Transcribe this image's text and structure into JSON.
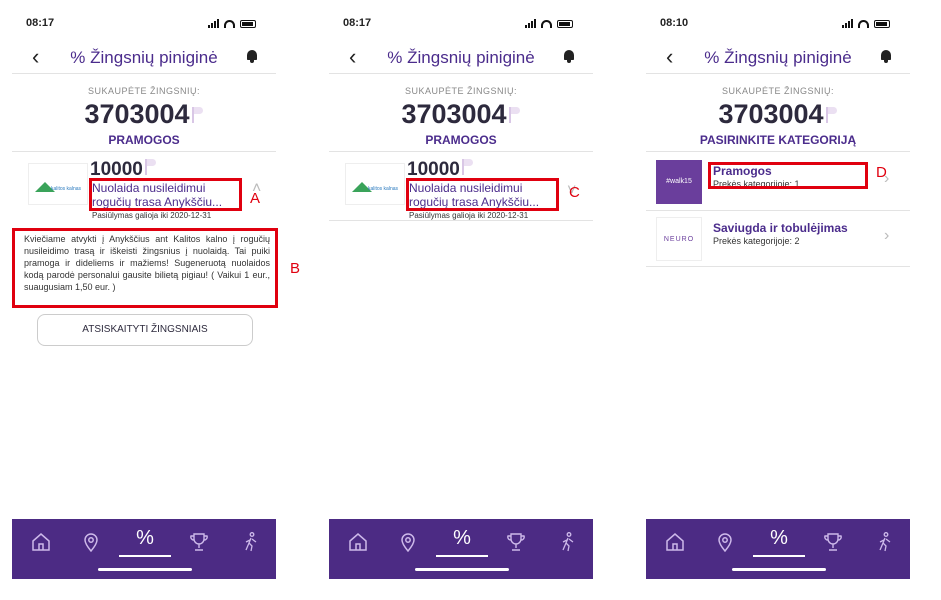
{
  "screens": [
    {
      "time": "08:17",
      "nav_title": "% Žingsnių piniginė",
      "earned_label": "SUKAUPĖTE ŽINGSNIŲ:",
      "steps": "3703004",
      "category": "PRAMOGOS",
      "offer": {
        "points": "10000",
        "name": "Nuolaida nusileidimui rogučių trasa Anykščiu...",
        "valid": "Pasiūlymas galioja iki 2020-12-31",
        "logo_text": "kalitos kalnas"
      },
      "description": "Kviečiame atvykti į Anykščius ant Kalitos kalno į rogučių nusileidimo trasą ir iškeisti žingsnius į nuolaidą. Tai puiki pramoga ir dideliems ir mažiems! Sugeneruotą nuolaidos kodą parodė personalui gausite bilietą pigiau! ( Vaikui 1 eur., suaugusiam 1,50 eur. )",
      "button": "ATSISKAITYTI ŽINGSNIAIS",
      "marks": [
        "A",
        "B"
      ]
    },
    {
      "time": "08:17",
      "nav_title": "% Žingsnių piniginė",
      "earned_label": "SUKAUPĖTE ŽINGSNIŲ:",
      "steps": "3703004",
      "category": "PRAMOGOS",
      "offer": {
        "points": "10000",
        "name": "Nuolaida nusileidimui rogučių trasa Anykščiu...",
        "valid": "Pasiūlymas galioja iki 2020-12-31",
        "logo_text": "kalitos kalnas"
      },
      "marks": [
        "C"
      ]
    },
    {
      "time": "08:10",
      "nav_title": "% Žingsnių piniginė",
      "earned_label": "SUKAUPĖTE ŽINGSNIŲ:",
      "steps": "3703004",
      "category": "PASIRINKITE KATEGORIJĄ",
      "categories": [
        {
          "title": "Pramogos",
          "sub": "Prekės kategorijoje: 1",
          "thumb": "#walk15"
        },
        {
          "title": "Saviugda ir tobulėjimas",
          "sub": "Prekės kategorijoje: 2",
          "thumb": "NEURO"
        }
      ],
      "marks": [
        "D"
      ]
    }
  ],
  "tabs": [
    "home-icon",
    "location-pin-icon",
    "percent-icon",
    "trophy-icon",
    "walking-icon"
  ],
  "colors": {
    "accent": "#4b2c8c",
    "tabbar": "#4c2b84",
    "annotation": "#e0000f"
  }
}
